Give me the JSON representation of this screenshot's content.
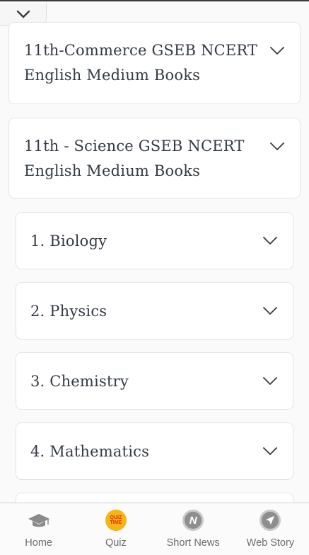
{
  "cards": [
    {
      "title_line1": "11th-Commerce GSEB NCERT",
      "title_line2": "English Medium Books"
    },
    {
      "title_line1": "11th - Science GSEB NCERT",
      "title_line2": "English Medium Books"
    }
  ],
  "subjects": [
    {
      "label": "1. Biology"
    },
    {
      "label": "2. Physics"
    },
    {
      "label": "3. Chemistry"
    },
    {
      "label": "4. Mathematics"
    }
  ],
  "bottom_nav": {
    "items": [
      {
        "label": "Home",
        "icon": "graduation-cap-icon"
      },
      {
        "label": "Quiz",
        "icon": "quiz-time-icon",
        "badge_line1": "QUIZ",
        "badge_line2": "TIME"
      },
      {
        "label": "Short News",
        "icon": "news-n-icon",
        "glyph": "N"
      },
      {
        "label": "Web Story",
        "icon": "paper-plane-icon"
      }
    ]
  },
  "colors": {
    "accent_quiz": "#f7b515",
    "text": "#333a44",
    "nav_text": "#6d6d6d"
  }
}
